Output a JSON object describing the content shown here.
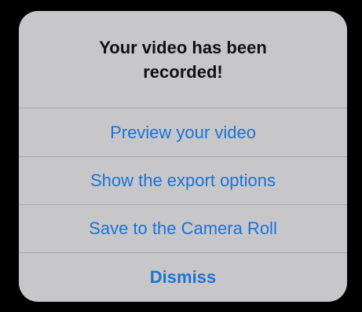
{
  "alert": {
    "title": "Your video has been recorded!",
    "actions": [
      {
        "label": "Preview your video"
      },
      {
        "label": "Show the export options"
      },
      {
        "label": "Save to the Camera Roll"
      },
      {
        "label": "Dismiss"
      }
    ]
  },
  "colors": {
    "background": "#000000",
    "alert_background": "#c7c7c9",
    "action_tint": "#1a73d9",
    "separator": "#a9a9ad"
  }
}
